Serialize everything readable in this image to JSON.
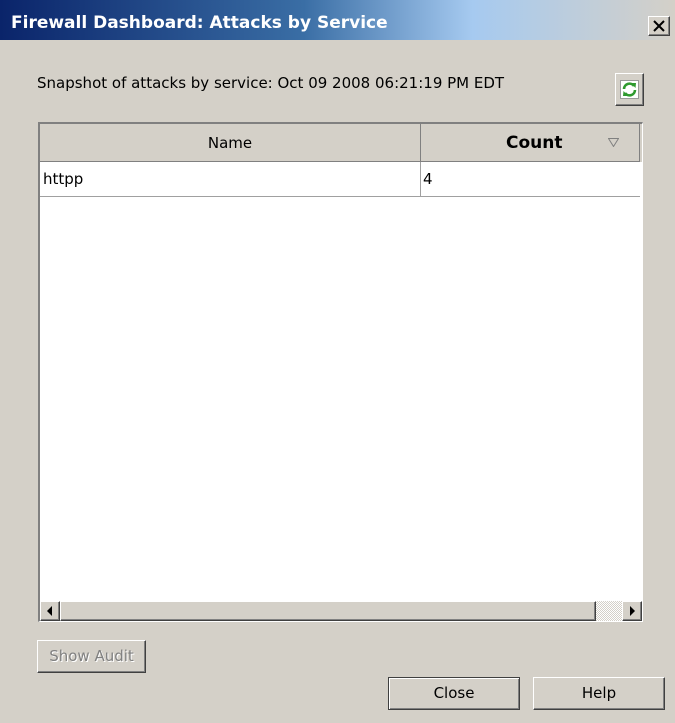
{
  "window": {
    "title": "Firewall Dashboard: Attacks by Service",
    "close_icon": "close-x-icon"
  },
  "snapshot": {
    "label": "Snapshot of attacks by service: Oct 09 2008 06:21:19 PM EDT"
  },
  "refresh": {
    "icon": "refresh-icon",
    "color": "#2f9a2f"
  },
  "table": {
    "columns": [
      "Name",
      "Count"
    ],
    "sort_column": "Count",
    "sort_direction": "descending",
    "rows": [
      {
        "name": "httpp",
        "count": "4"
      }
    ]
  },
  "buttons": {
    "show_audit": "Show Audit",
    "close": "Close",
    "help": "Help"
  },
  "colors": {
    "titlebar_start": "#0a246a",
    "titlebar_end": "#a6caf0",
    "face": "#d4d0c8"
  }
}
